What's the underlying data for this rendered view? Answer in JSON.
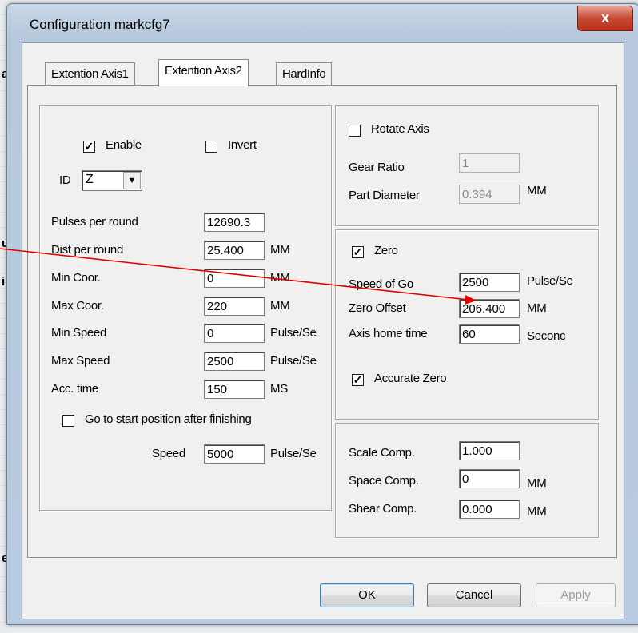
{
  "background": {
    "fragments": [
      "a",
      "u",
      "i",
      "e"
    ]
  },
  "window": {
    "title": "Configuration markcfg7",
    "close_glyph": "x"
  },
  "tabs": [
    "Extention Axis1",
    "Extention Axis2",
    "HardInfo"
  ],
  "left": {
    "enable_label": "Enable",
    "enable_checked": true,
    "invert_label": "Invert",
    "invert_checked": false,
    "id_label": "ID",
    "id_value": "Z",
    "rows": [
      {
        "label": "Pulses per round",
        "value": "12690.3",
        "unit": ""
      },
      {
        "label": "Dist per round",
        "value": "25.400",
        "unit": "MM"
      },
      {
        "label": "Min Coor.",
        "value": "0",
        "unit": "MM"
      },
      {
        "label": "Max Coor.",
        "value": "220",
        "unit": "MM"
      },
      {
        "label": "Min Speed",
        "value": "0",
        "unit": "Pulse/Se"
      },
      {
        "label": "Max Speed",
        "value": "2500",
        "unit": "Pulse/Se"
      },
      {
        "label": "Acc. time",
        "value": "150",
        "unit": "MS"
      }
    ],
    "go_start_label": "Go to start position after finishing",
    "go_start_checked": false,
    "speed_label": "Speed",
    "speed_value": "5000",
    "speed_unit": "Pulse/Se"
  },
  "rotate": {
    "label": "Rotate Axis",
    "checked": false,
    "gear_label": "Gear Ratio",
    "gear_value": "1",
    "diam_label": "Part Diameter",
    "diam_value": "0.394",
    "diam_unit": "MM"
  },
  "zero": {
    "label": "Zero",
    "checked": true,
    "speed_label": "Speed of Go",
    "speed_value": "2500",
    "speed_unit": "Pulse/Se",
    "offset_label": "Zero Offset",
    "offset_value": "206.400",
    "offset_unit": "MM",
    "home_label": "Axis home time",
    "home_value": "60",
    "home_unit": "Seconc",
    "accurate_label": "Accurate Zero",
    "accurate_checked": true
  },
  "comp": {
    "scale_label": "Scale Comp.",
    "scale_value": "1.000",
    "space_label": "Space Comp.",
    "space_value": "0",
    "space_unit": "MM",
    "shear_label": "Shear Comp.",
    "shear_value": "0.000",
    "shear_unit": "MM"
  },
  "buttons": {
    "ok": "OK",
    "cancel": "Cancel",
    "apply": "Apply"
  },
  "colors": {
    "annotation_arrow": "#e00000"
  },
  "check_glyph": "✓"
}
